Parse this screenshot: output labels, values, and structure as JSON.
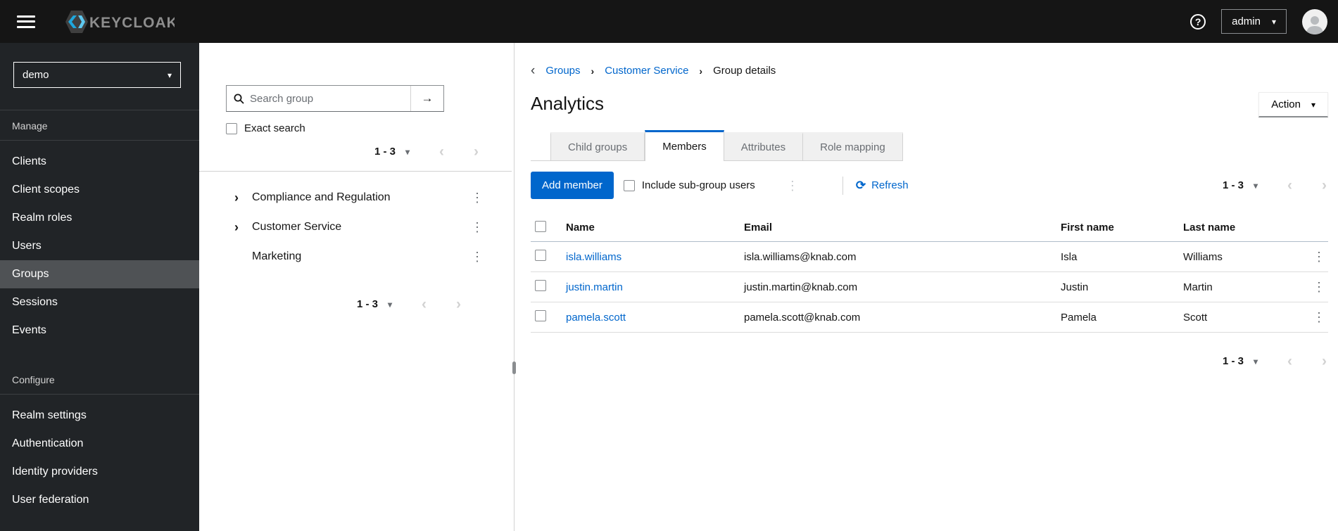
{
  "icons": {
    "caret_down": "▾",
    "angle_left": "‹",
    "angle_right": "›",
    "breadcrumb_sep": "›",
    "kebab": "⋮",
    "search_submit": "→",
    "refresh": "⟳",
    "help": "?"
  },
  "colors": {
    "accent": "#0066cc",
    "masthead_bg": "#151515",
    "sidebar_bg": "#212427",
    "sidebar_active_bg": "#4f5255",
    "link": "#0066cc",
    "active_tab_border": "#0066cc"
  },
  "masthead": {
    "brand": "KEYCLOAK",
    "user_menu_label": "admin"
  },
  "sidebar": {
    "realm_select_value": "demo",
    "sections": [
      {
        "label": "Manage",
        "items": [
          "Clients",
          "Client scopes",
          "Realm roles",
          "Users",
          "Groups",
          "Sessions",
          "Events"
        ],
        "active_item": "Groups"
      },
      {
        "label": "Configure",
        "items": [
          "Realm settings",
          "Authentication",
          "Identity providers",
          "User federation"
        ]
      }
    ]
  },
  "tree_panel": {
    "search_placeholder": "Search group",
    "exact_search_label": "Exact search",
    "pagination_range": "1 - 3",
    "groups": [
      {
        "name": "Compliance and Regulation",
        "expandable": true
      },
      {
        "name": "Customer Service",
        "expandable": true
      },
      {
        "name": "Marketing",
        "expandable": false
      }
    ]
  },
  "main": {
    "breadcrumb": [
      "Groups",
      "Customer Service",
      "Group details"
    ],
    "title": "Analytics",
    "action_button_label": "Action",
    "tabs": [
      {
        "label": "Child groups",
        "active": false
      },
      {
        "label": "Members",
        "active": true
      },
      {
        "label": "Attributes",
        "active": false
      },
      {
        "label": "Role mapping",
        "active": false
      }
    ],
    "toolbar": {
      "add_member_label": "Add member",
      "include_subgroup_label": "Include sub-group users",
      "refresh_label": "Refresh",
      "pagination_range": "1 - 3"
    },
    "table": {
      "columns": [
        "Name",
        "Email",
        "First name",
        "Last name"
      ],
      "rows": [
        {
          "name": "isla.williams",
          "email": "isla.williams@knab.com",
          "first_name": "Isla",
          "last_name": "Williams"
        },
        {
          "name": "justin.martin",
          "email": "justin.martin@knab.com",
          "first_name": "Justin",
          "last_name": "Martin"
        },
        {
          "name": "pamela.scott",
          "email": "pamela.scott@knab.com",
          "first_name": "Pamela",
          "last_name": "Scott"
        }
      ],
      "pagination_range": "1 - 3"
    }
  }
}
